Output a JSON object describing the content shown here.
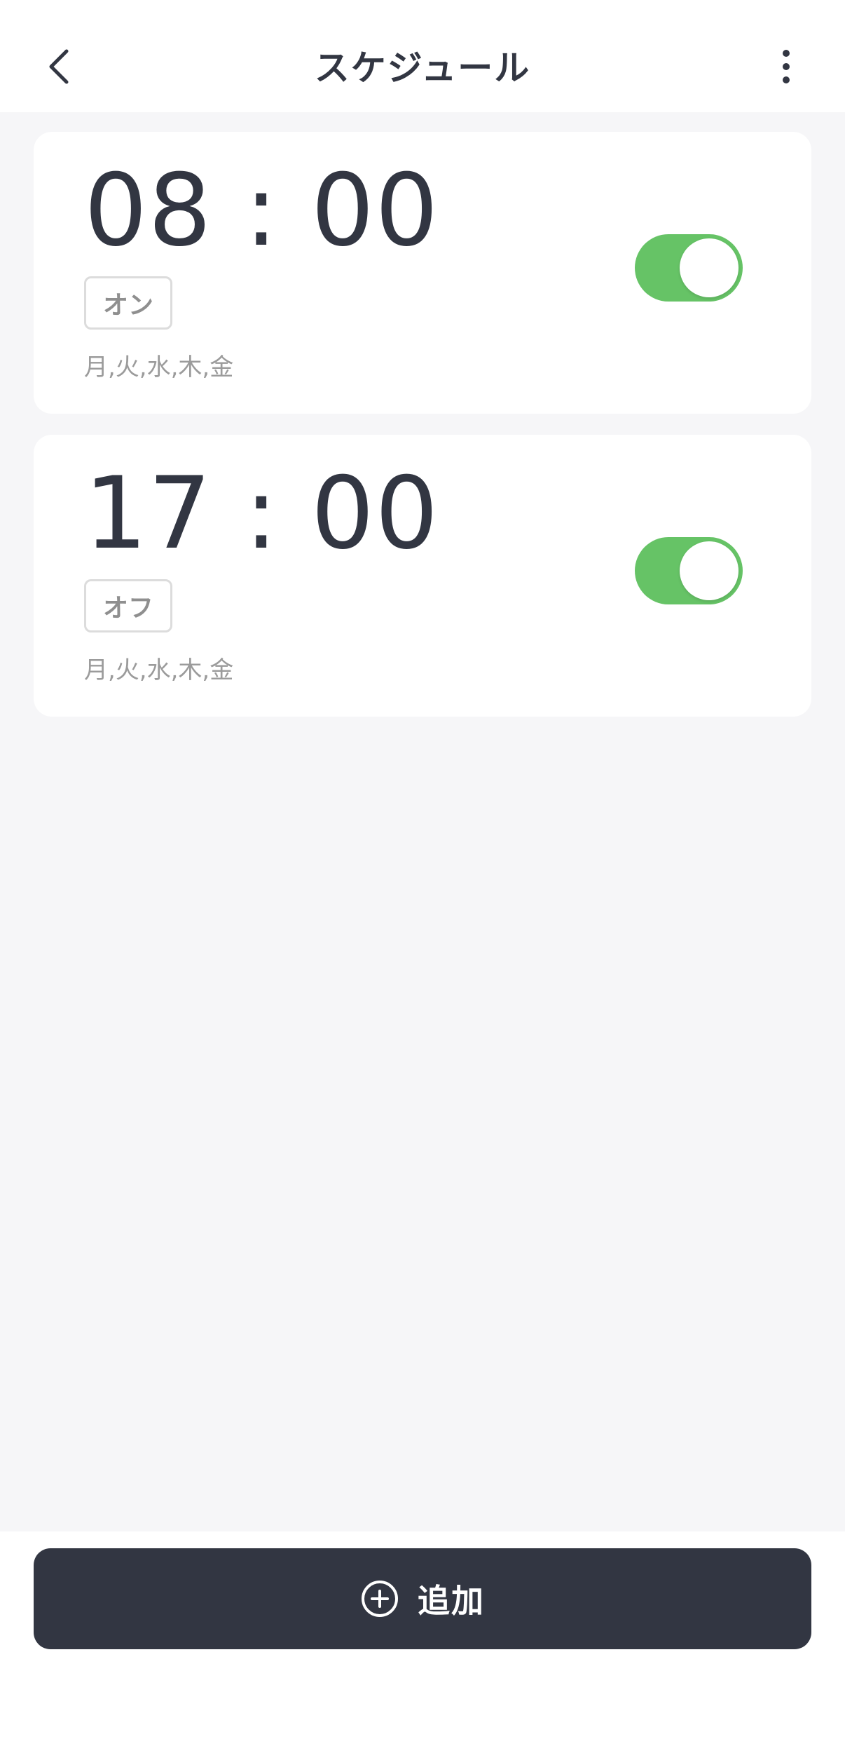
{
  "header": {
    "title": "スケジュール",
    "back_icon": "chevron-left-icon",
    "more_icon": "more-vertical-icon"
  },
  "schedules": [
    {
      "time": "08 : 00",
      "action": "オン",
      "days": "月,火,水,木,金",
      "enabled": true
    },
    {
      "time": "17 : 00",
      "action": "オフ",
      "days": "月,火,水,木,金",
      "enabled": true
    }
  ],
  "footer": {
    "add_label": "追加",
    "add_icon": "plus-circle-icon"
  },
  "colors": {
    "toggle_on": "#66c366",
    "primary_dark": "#323642",
    "background": "#f6f6f8"
  }
}
